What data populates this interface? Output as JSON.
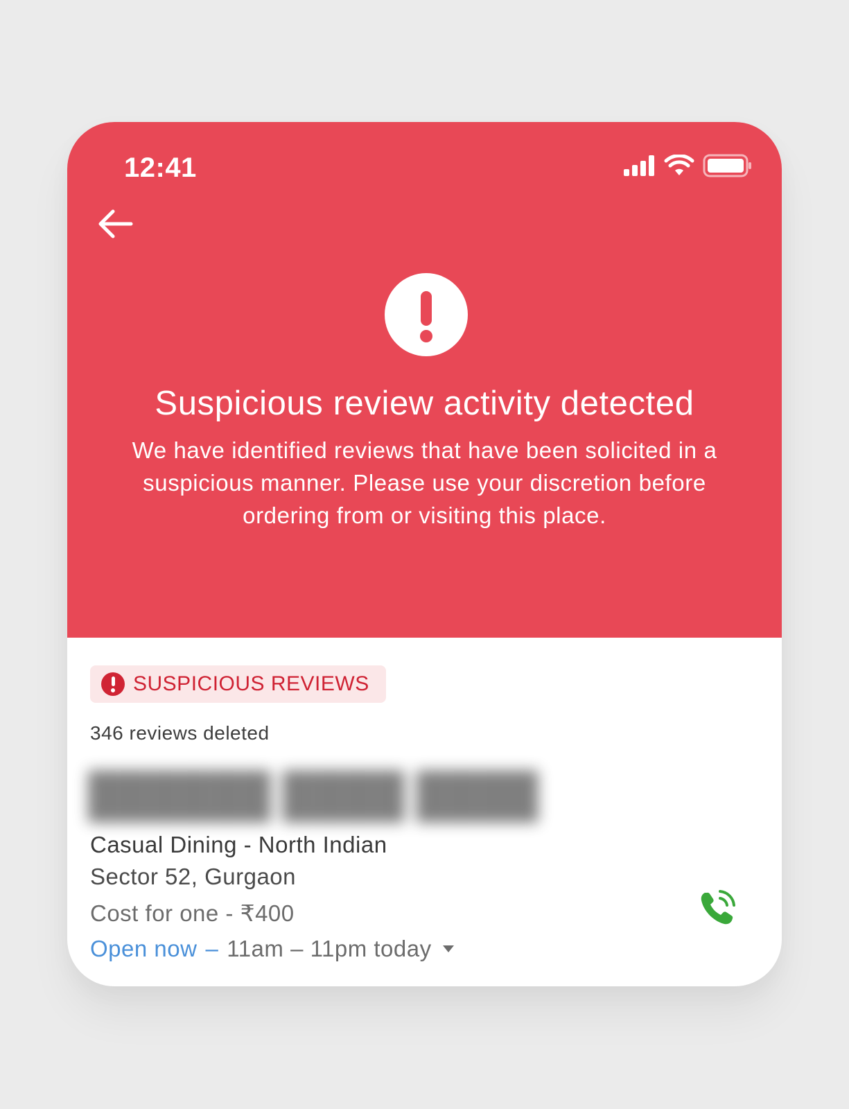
{
  "status_bar": {
    "time": "12:41"
  },
  "colors": {
    "hero_bg": "#e84856",
    "badge_bg": "#fbe7e8",
    "badge_text": "#cf2233",
    "link_blue": "#4a90d9",
    "call_green": "#3aa83a"
  },
  "icons": {
    "back": "arrow-left-icon",
    "alert": "exclamation-circle-icon",
    "badge": "exclamation-circle-icon",
    "call": "phone-call-icon",
    "caret": "caret-down-icon",
    "signal": "cellular-signal-icon",
    "wifi": "wifi-icon",
    "battery": "battery-icon"
  },
  "warning": {
    "title": "Suspicious review activity detected",
    "body": "We have identified reviews that have been solicited in a suspicious manner. Please use your discretion before ordering from or visiting this place."
  },
  "restaurant": {
    "badge_label": "SUSPICIOUS REVIEWS",
    "deleted_count": "346 reviews deleted",
    "cuisine": "Casual Dining - North Indian",
    "locality": "Sector 52, Gurgaon",
    "cost": "Cost for one - ₹400",
    "open_status": "Open now",
    "hours": "11am – 11pm today"
  }
}
